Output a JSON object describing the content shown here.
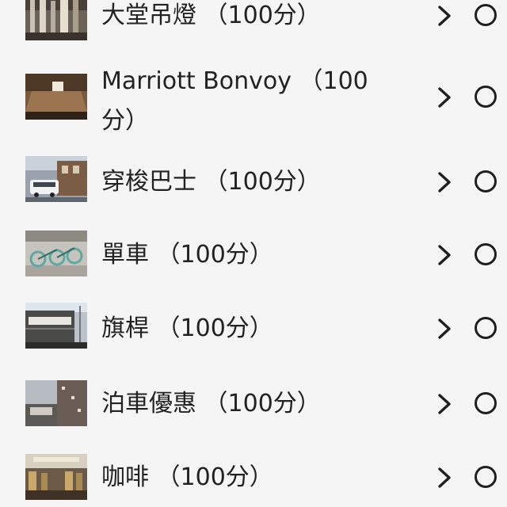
{
  "items": [
    {
      "label": "大堂吊燈 （100分）",
      "thumb": "lobby-chandelier-photo"
    },
    {
      "label": "Marriott Bonvoy （100",
      "label_line2": "分）",
      "thumb": "marriott-bonvoy-counter-photo"
    },
    {
      "label": "穿梭巴士 （100分）",
      "thumb": "shuttle-bus-photo"
    },
    {
      "label": "單車 （100分）",
      "thumb": "bicycles-photo"
    },
    {
      "label": "旗桿 （100分）",
      "thumb": "flagpole-photo"
    },
    {
      "label": "泊車優惠 （100分）",
      "thumb": "parking-photo"
    },
    {
      "label": "咖啡 （100分）",
      "thumb": "cafe-photo"
    }
  ],
  "icons": {
    "chevron": "chevron-right-icon",
    "radio": "radio-unchecked-icon"
  },
  "colors": {
    "background": "#f6f5f6",
    "text": "#222222",
    "icon": "#1f1f1f"
  }
}
